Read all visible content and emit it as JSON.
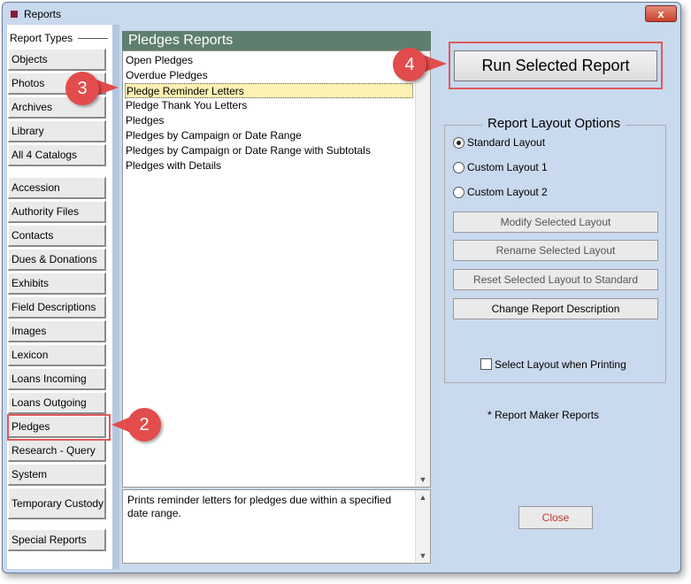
{
  "window": {
    "title": "Reports",
    "close_glyph": "x"
  },
  "sidebar": {
    "group_label": "Report Types",
    "items": [
      "Objects",
      "Photos",
      "Archives",
      "Library",
      "All 4 Catalogs",
      "Accession",
      "Authority Files",
      "Contacts",
      "Dues & Donations",
      "Exhibits",
      "Field Descriptions",
      "Images",
      "Lexicon",
      "Loans Incoming",
      "Loans Outgoing",
      "Pledges",
      "Research - Query",
      "System",
      "Temporary Custody",
      "Special Reports"
    ],
    "selected": "Pledges"
  },
  "report_list": {
    "header": "Pledges Reports",
    "items": [
      "Open Pledges",
      "Overdue Pledges",
      "Pledge Reminder Letters",
      "Pledge Thank You Letters",
      "Pledges",
      "Pledges by Campaign or Date Range",
      "Pledges by Campaign or Date Range with Subtotals",
      "Pledges with Details"
    ],
    "selected": "Pledge Reminder Letters"
  },
  "description": "Prints reminder letters for pledges due within a specified date range.",
  "run_button": "Run Selected Report",
  "layout_options": {
    "legend": "Report Layout Options",
    "radios": [
      "Standard Layout",
      "Custom Layout 1",
      "Custom Layout 2"
    ],
    "selected": "Standard Layout",
    "buttons": [
      "Modify Selected Layout",
      "Rename Selected Layout",
      "Reset Selected Layout to Standard",
      "Change Report Description"
    ],
    "checkbox_label": "Select Layout when Printing",
    "checkbox_checked": false
  },
  "report_maker_note": "* Report Maker Reports",
  "close_button": "Close",
  "callouts": [
    "2",
    "3",
    "4"
  ],
  "colors": {
    "callout": "#e24c4c",
    "selected_row": "#fdf1b3",
    "header_green": "#5f7f6e",
    "window_blue": "#c9d9ee"
  }
}
